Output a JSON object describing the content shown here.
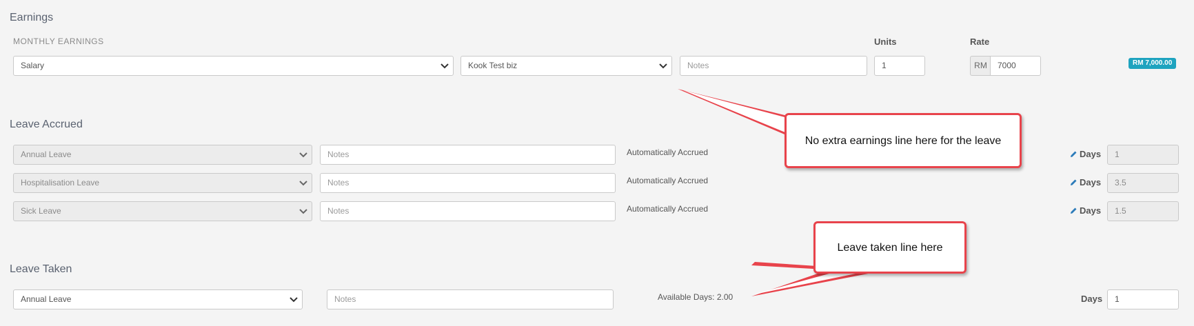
{
  "earnings": {
    "title": "Earnings",
    "subtitle": "MONTHLY EARNINGS",
    "units_label": "Units",
    "rate_label": "Rate",
    "type_select": "Salary",
    "business_select": "Kook Test biz",
    "notes_placeholder": "Notes",
    "units_value": "1",
    "currency": "RM",
    "rate_value": "7000",
    "total_badge": "RM 7,000.00"
  },
  "leave_accrued": {
    "title": "Leave Accrued",
    "rows": [
      {
        "type": "Annual Leave",
        "notes_placeholder": "Notes",
        "status": "Automatically Accrued",
        "days_label": "Days",
        "days": "1"
      },
      {
        "type": "Hospitalisation Leave",
        "notes_placeholder": "Notes",
        "status": "Automatically Accrued",
        "days_label": "Days",
        "days": "3.5"
      },
      {
        "type": "Sick Leave",
        "notes_placeholder": "Notes",
        "status": "Automatically Accrued",
        "days_label": "Days",
        "days": "1.5"
      }
    ]
  },
  "leave_taken": {
    "title": "Leave Taken",
    "type_select": "Annual Leave",
    "notes_placeholder": "Notes",
    "available": "Available Days: 2.00",
    "days_label": "Days",
    "days_value": "1"
  },
  "callouts": {
    "no_extra": "No extra earnings line here for the leave",
    "taken": "Leave taken line here"
  },
  "colors": {
    "accent": "#1ea3bf",
    "callout_border": "#e8434b",
    "pencil": "#2b7bb9"
  },
  "icons": [
    "chevron-down-icon",
    "pencil-icon"
  ]
}
